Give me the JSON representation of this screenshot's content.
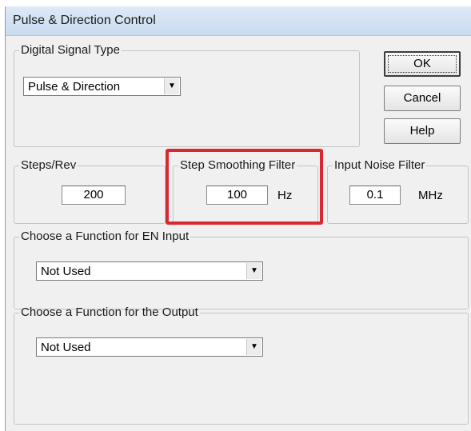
{
  "window": {
    "title": "Pulse & Direction Control"
  },
  "digital_signal": {
    "legend": "Digital Signal Type",
    "selected": "Pulse & Direction"
  },
  "buttons": {
    "ok": "OK",
    "cancel": "Cancel",
    "help": "Help"
  },
  "steps_rev": {
    "legend": "Steps/Rev",
    "value": "200"
  },
  "step_smoothing": {
    "legend": "Step Smoothing Filter",
    "value": "100",
    "unit": "Hz"
  },
  "input_noise": {
    "legend": "Input Noise Filter",
    "value": "0.1",
    "unit": "MHz"
  },
  "en_input": {
    "legend": "Choose a Function for EN Input",
    "selected": "Not Used"
  },
  "output_fn": {
    "legend": "Choose a Function for the Output",
    "selected": "Not Used"
  },
  "icons": {
    "dropdown": "chevron-down-icon"
  },
  "colors": {
    "highlight": "#d9282f"
  }
}
